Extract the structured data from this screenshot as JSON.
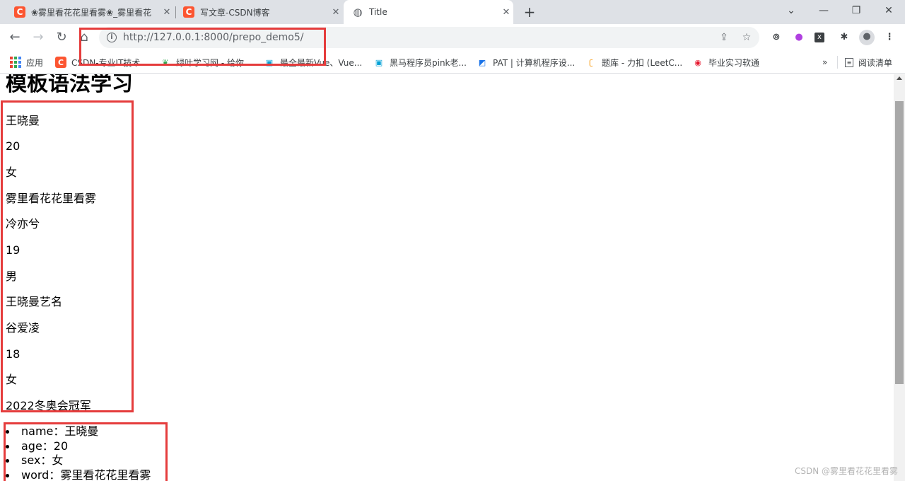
{
  "tabs": [
    {
      "title": "❀雾里看花花里看雾❀_雾里看花",
      "favicon": "csdn-icon"
    },
    {
      "title": "写文章-CSDN博客",
      "favicon": "csdn-icon"
    },
    {
      "title": "Title",
      "favicon": "globe-icon"
    }
  ],
  "favicon_letter": "C",
  "address_bar": {
    "url_host": "http://127.0.0.1",
    "url_rest": ":8000/prepo_demo5/"
  },
  "bookmarks": [
    {
      "label": "应用",
      "icon": "apps-grid-icon"
    },
    {
      "label": "CSDN-专业IT技术...",
      "icon": "csdn-icon"
    },
    {
      "label": "绿叶学习网 - 给你...",
      "icon": "leaf-icon"
    },
    {
      "label": "最全最新Vue、Vue...",
      "icon": "bilibili-icon"
    },
    {
      "label": "黑马程序员pink老...",
      "icon": "bilibili-icon"
    },
    {
      "label": "PAT | 计算机程序设...",
      "icon": "pat-icon"
    },
    {
      "label": "题库 - 力扣 (LeetC...",
      "icon": "leetcode-icon"
    },
    {
      "label": "毕业实习软通",
      "icon": "weibo-icon"
    }
  ],
  "reading_list": "阅读清单",
  "page": {
    "title": "模板语法学习",
    "fields": [
      "王晓曼",
      "20",
      "女",
      "雾里看花花里看雾",
      "冷亦兮",
      "19",
      "男",
      "王晓曼艺名",
      "谷爱凌",
      "18",
      "女",
      "2022冬奥会冠军"
    ],
    "list": [
      "name：王晓曼",
      "age：20",
      "sex：女",
      "word：雾里看花花里看雾"
    ]
  },
  "watermark": "CSDN @雾里看花花里看雾",
  "colors": {
    "annotation_red": "#e53c3c",
    "csdn_orange": "#fc5531",
    "tabstrip_bg": "#dee1e6"
  }
}
